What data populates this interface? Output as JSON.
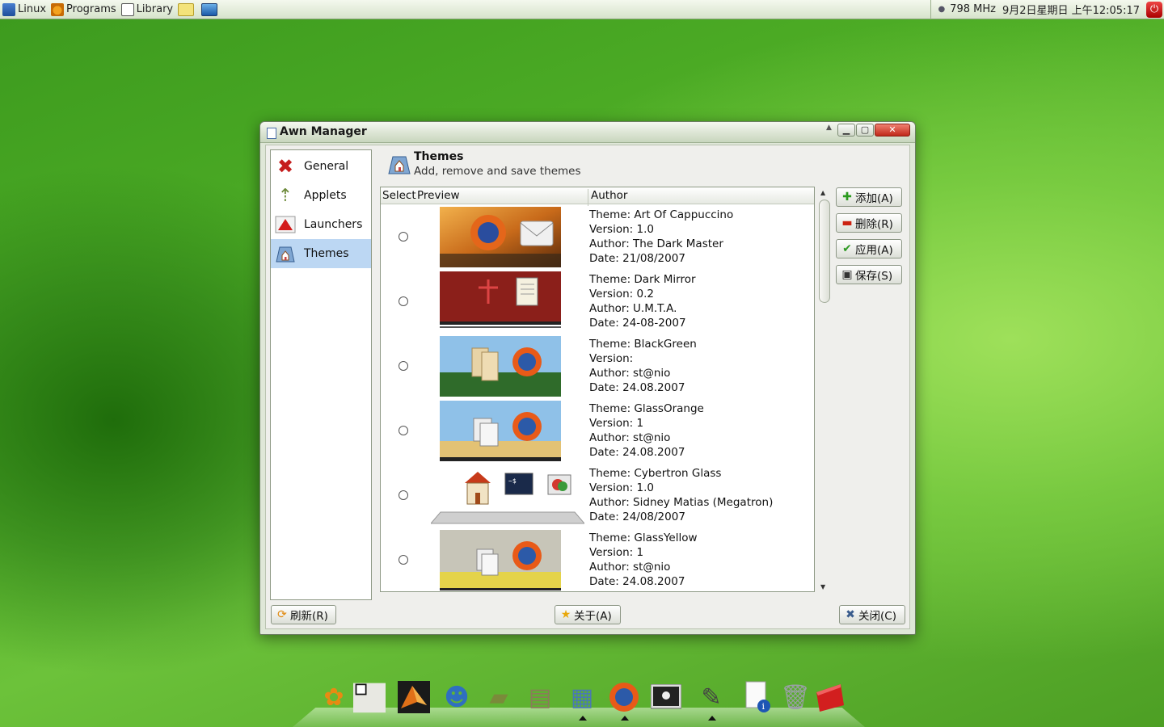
{
  "top_panel": {
    "menus": [
      {
        "label": "Linux",
        "icon": "linux-icon"
      },
      {
        "label": "Programs",
        "icon": "programs-icon"
      },
      {
        "label": "Library",
        "icon": "library-icon"
      }
    ],
    "cpu_freq": "798 MHz",
    "datetime": "9月2日星期日 上午12:05:17"
  },
  "window": {
    "title": "Awn Manager",
    "sidebar": {
      "items": [
        {
          "label": "General",
          "icon": "tools-icon"
        },
        {
          "label": "Applets",
          "icon": "applets-icon"
        },
        {
          "label": "Launchers",
          "icon": "launcher-icon"
        },
        {
          "label": "Themes",
          "icon": "themes-icon",
          "active": true
        }
      ]
    },
    "header": {
      "title": "Themes",
      "subtitle": "Add, remove and save themes"
    },
    "list": {
      "columns": {
        "select": "Select",
        "preview": "Preview",
        "author": "Author"
      },
      "rows": [
        {
          "theme": "Theme: Art Of Cappuccino",
          "version": "Version: 1.0",
          "author": "Author: The Dark Master",
          "date": "Date: 21/08/2007"
        },
        {
          "theme": "Theme: Dark Mirror",
          "version": "Version: 0.2",
          "author": "Author: U.M.T.A.",
          "date": "Date: 24-08-2007"
        },
        {
          "theme": "Theme: BlackGreen",
          "version": "Version:",
          "author": "Author: st@nio",
          "date": "Date: 24.08.2007"
        },
        {
          "theme": "Theme: GlassOrange",
          "version": "Version: 1",
          "author": "Author: st@nio",
          "date": "Date: 24.08.2007"
        },
        {
          "theme": "Theme: Cybertron Glass",
          "version": "Version: 1.0",
          "author": "Author: Sidney Matias (Megatron)",
          "date": "Date: 24/08/2007"
        },
        {
          "theme": "Theme: GlassYellow",
          "version": "Version: 1",
          "author": "Author: st@nio",
          "date": "Date: 24.08.2007"
        }
      ]
    },
    "side_buttons": {
      "add": "添加(A)",
      "remove": "删除(R)",
      "apply": "应用(A)",
      "save": "保存(S)"
    },
    "footer_buttons": {
      "refresh": "刷新(R)",
      "about": "关于(A)",
      "close": "关闭(C)"
    }
  },
  "dock": {
    "icons": [
      "gnome-foot-icon",
      "window-icon",
      "matlab-icon",
      "users-icon",
      "book-icon",
      "clipboard-icon",
      "file-manager-icon",
      "firefox-icon",
      "terminal-icon",
      "pen-icon",
      "info-document-icon",
      "trash-icon",
      "red-folder-icon"
    ]
  }
}
